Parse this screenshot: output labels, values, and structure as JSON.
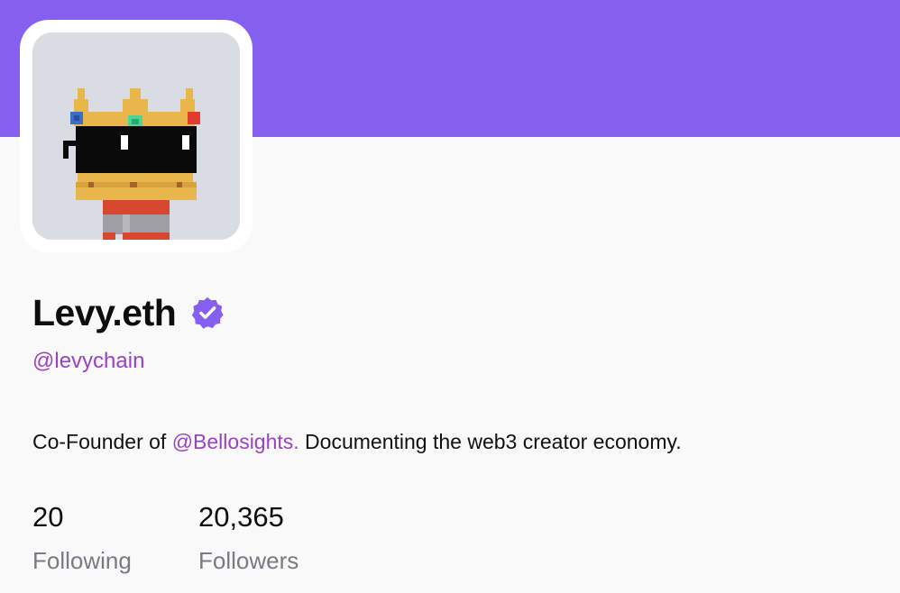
{
  "profile": {
    "display_name": "Levy.eth",
    "verified": true,
    "handle": "@levychain",
    "bio": {
      "prefix": "Co-Founder of ",
      "mention": "@Bellosights.",
      "suffix": " Documenting the web3 creator economy."
    },
    "stats": {
      "following_count": "20",
      "following_label": "Following",
      "followers_count": "20,365",
      "followers_label": "Followers"
    }
  },
  "colors": {
    "cover": "#8560ef",
    "accent": "#9b41c4",
    "verified_badge": "#8560ef",
    "muted_text": "#7a7a82"
  },
  "icons": {
    "verified": "verified-badge-icon",
    "avatar": "pixel-crown-sunglasses-avatar"
  }
}
